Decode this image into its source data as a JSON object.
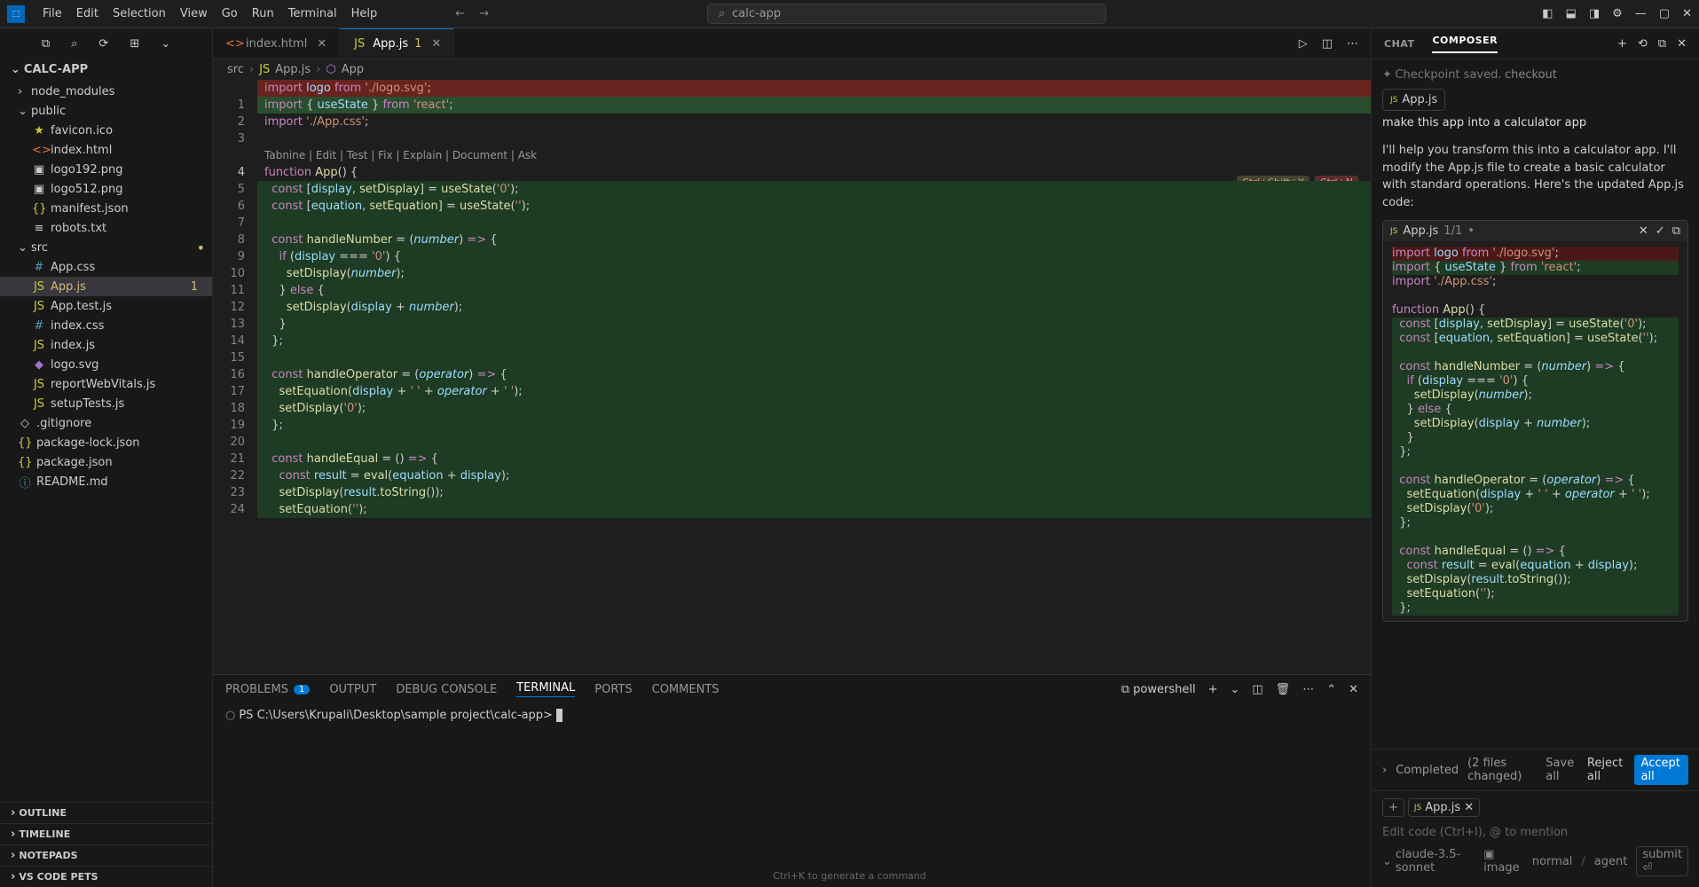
{
  "menubar": {
    "items": [
      "File",
      "Edit",
      "Selection",
      "View",
      "Go",
      "Run",
      "Terminal",
      "Help"
    ],
    "search": "calc-app"
  },
  "explorer": {
    "title": "CALC-APP",
    "tree": [
      {
        "type": "folder",
        "name": "node_modules",
        "expanded": false,
        "depth": 0
      },
      {
        "type": "folder",
        "name": "public",
        "expanded": true,
        "depth": 0
      },
      {
        "type": "file",
        "name": "favicon.ico",
        "icon": "star",
        "depth": 1
      },
      {
        "type": "file",
        "name": "index.html",
        "icon": "html",
        "depth": 1
      },
      {
        "type": "file",
        "name": "logo192.png",
        "icon": "img",
        "depth": 1
      },
      {
        "type": "file",
        "name": "logo512.png",
        "icon": "img",
        "depth": 1
      },
      {
        "type": "file",
        "name": "manifest.json",
        "icon": "json",
        "depth": 1
      },
      {
        "type": "file",
        "name": "robots.txt",
        "icon": "txt",
        "depth": 1
      },
      {
        "type": "folder",
        "name": "src",
        "expanded": true,
        "depth": 0,
        "modified": true
      },
      {
        "type": "file",
        "name": "App.css",
        "icon": "css",
        "depth": 1
      },
      {
        "type": "file",
        "name": "App.js",
        "icon": "js",
        "depth": 1,
        "selected": true,
        "badge": "1"
      },
      {
        "type": "file",
        "name": "App.test.js",
        "icon": "js",
        "depth": 1
      },
      {
        "type": "file",
        "name": "index.css",
        "icon": "css",
        "depth": 1
      },
      {
        "type": "file",
        "name": "index.js",
        "icon": "js",
        "depth": 1
      },
      {
        "type": "file",
        "name": "logo.svg",
        "icon": "svg",
        "depth": 1
      },
      {
        "type": "file",
        "name": "reportWebVitals.js",
        "icon": "js",
        "depth": 1
      },
      {
        "type": "file",
        "name": "setupTests.js",
        "icon": "js",
        "depth": 1
      },
      {
        "type": "file",
        "name": ".gitignore",
        "icon": "git",
        "depth": 0
      },
      {
        "type": "file",
        "name": "package-lock.json",
        "icon": "json",
        "depth": 0
      },
      {
        "type": "file",
        "name": "package.json",
        "icon": "json",
        "depth": 0
      },
      {
        "type": "file",
        "name": "README.md",
        "icon": "md",
        "depth": 0
      }
    ],
    "sections": [
      "OUTLINE",
      "TIMELINE",
      "NOTEPADS",
      "VS CODE PETS"
    ]
  },
  "tabs": [
    {
      "name": "index.html",
      "icon": "html",
      "active": false
    },
    {
      "name": "App.js",
      "icon": "js",
      "active": true,
      "badge": "1"
    }
  ],
  "breadcrumb": [
    "src",
    "App.js",
    "App"
  ],
  "editor": {
    "hints": [
      "Ctrl+Shift+Y",
      "Ctrl+N"
    ],
    "codelens": "Tabnine | Edit | Test | Fix | Explain | Document | Ask",
    "lines": [
      {
        "n": "",
        "cls": "hl-red",
        "html": "<span class='kw'>import</span> <span class='var'>logo</span> <span class='kw'>from</span> <span class='str'>'./logo.svg'</span>;"
      },
      {
        "n": "1",
        "cls": "hl-grn",
        "html": "<span class='kw'>import</span> { <span class='var'>useState</span> } <span class='kw'>from</span> <span class='str'>'react'</span>;"
      },
      {
        "n": "2",
        "html": "<span class='kw'>import</span> <span class='str'>'./App.css'</span>;"
      },
      {
        "n": "3",
        "html": ""
      },
      {
        "n": "4",
        "cur": true,
        "html": "<span class='kw'>function</span> <span class='fn'>App</span>() {"
      },
      {
        "n": "5",
        "cls": "hl-grn2",
        "html": "  <span class='kw'>const</span> [<span class='var'>display</span>, <span class='fn'>setDisplay</span>] = <span class='fn'>useState</span>(<span class='str'>'0'</span>);"
      },
      {
        "n": "6",
        "cls": "hl-grn2",
        "html": "  <span class='kw'>const</span> [<span class='var'>equation</span>, <span class='fn'>setEquation</span>] = <span class='fn'>useState</span>(<span class='str'>''</span>);"
      },
      {
        "n": "7",
        "cls": "hl-grn2",
        "html": ""
      },
      {
        "n": "8",
        "cls": "hl-grn2",
        "html": "  <span class='kw'>const</span> <span class='fn'>handleNumber</span> = (<span class='param'>number</span>) <span class='kw'>=&gt;</span> {"
      },
      {
        "n": "9",
        "cls": "hl-grn2",
        "html": "    <span class='kw'>if</span> (<span class='var'>display</span> === <span class='str'>'0'</span>) {"
      },
      {
        "n": "10",
        "cls": "hl-grn2",
        "html": "      <span class='fn'>setDisplay</span>(<span class='param'>number</span>);"
      },
      {
        "n": "11",
        "cls": "hl-grn2",
        "html": "    } <span class='kw'>else</span> {"
      },
      {
        "n": "12",
        "cls": "hl-grn2",
        "html": "      <span class='fn'>setDisplay</span>(<span class='var'>display</span> + <span class='param'>number</span>);"
      },
      {
        "n": "13",
        "cls": "hl-grn2",
        "html": "    }"
      },
      {
        "n": "14",
        "cls": "hl-grn2",
        "html": "  };"
      },
      {
        "n": "15",
        "cls": "hl-grn2",
        "html": ""
      },
      {
        "n": "16",
        "cls": "hl-grn2",
        "html": "  <span class='kw'>const</span> <span class='fn'>handleOperator</span> = (<span class='param'>operator</span>) <span class='kw'>=&gt;</span> {"
      },
      {
        "n": "17",
        "cls": "hl-grn2",
        "html": "    <span class='fn'>setEquation</span>(<span class='var'>display</span> + <span class='str'>' '</span> + <span class='param'>operator</span> + <span class='str'>' '</span>);"
      },
      {
        "n": "18",
        "cls": "hl-grn2",
        "html": "    <span class='fn'>setDisplay</span>(<span class='str'>'0'</span>);"
      },
      {
        "n": "19",
        "cls": "hl-grn2",
        "html": "  };"
      },
      {
        "n": "20",
        "cls": "hl-grn2",
        "html": ""
      },
      {
        "n": "21",
        "cls": "hl-grn2",
        "html": "  <span class='kw'>const</span> <span class='fn'>handleEqual</span> = () <span class='kw'>=&gt;</span> {"
      },
      {
        "n": "22",
        "cls": "hl-grn2",
        "html": "    <span class='kw'>const</span> <span class='var'>result</span> = <span class='fn'>eval</span>(<span class='var'>equation</span> + <span class='var'>display</span>);"
      },
      {
        "n": "23",
        "cls": "hl-grn2",
        "html": "    <span class='fn'>setDisplay</span>(<span class='var'>result</span>.<span class='fn'>toString</span>());"
      },
      {
        "n": "24",
        "cls": "hl-grn2",
        "html": "    <span class='fn'>setEquation</span>(<span class='str'>''</span>);"
      }
    ]
  },
  "panel": {
    "tabs": [
      "PROBLEMS",
      "OUTPUT",
      "DEBUG CONSOLE",
      "TERMINAL",
      "PORTS",
      "COMMENTS"
    ],
    "active": "TERMINAL",
    "problems_badge": "1",
    "shell": "powershell",
    "prompt": "PS C:\\Users\\Krupali\\Desktop\\sample project\\calc-app>",
    "ghost": "Ctrl+K to generate a command"
  },
  "composer": {
    "tabs": [
      "CHAT",
      "COMPOSER"
    ],
    "active": "COMPOSER",
    "checkpoint": "Checkpoint saved.",
    "checkpoint_action": "checkout",
    "context_file": "App.js",
    "user": "make this app into a calculator app",
    "assistant": "I'll help you transform this into a calculator app. I'll modify the App.js file to create a basic calculator with standard operations. Here's the updated App.js code:",
    "codeblock": {
      "file": "App.js",
      "meta": "1/1",
      "lines": [
        {
          "cls": "hl-red",
          "html": "<span class='kw'>import</span> <span class='var'>logo</span> <span class='kw'>from</span> <span class='str'>'./logo.svg'</span>;"
        },
        {
          "cls": "hl-grn",
          "html": "<span class='kw'>import</span> { <span class='var'>useState</span> } <span class='kw'>from</span> <span class='str'>'react'</span>;"
        },
        {
          "html": "<span class='kw'>import</span> <span class='str'>'./App.css'</span>;"
        },
        {
          "html": ""
        },
        {
          "html": "<span class='kw'>function</span> <span class='fn'>App</span>() {"
        },
        {
          "cls": "hl-grn",
          "html": "  <span class='kw'>const</span> [<span class='var'>display</span>, <span class='fn'>setDisplay</span>] = <span class='fn'>useState</span>(<span class='str'>'0'</span>);"
        },
        {
          "cls": "hl-grn",
          "html": "  <span class='kw'>const</span> [<span class='var'>equation</span>, <span class='fn'>setEquation</span>] = <span class='fn'>useState</span>(<span class='str'>''</span>);"
        },
        {
          "cls": "hl-grn",
          "html": ""
        },
        {
          "cls": "hl-grn",
          "html": "  <span class='kw'>const</span> <span class='fn'>handleNumber</span> = (<span class='param'>number</span>) <span class='kw'>=&gt;</span> {"
        },
        {
          "cls": "hl-grn",
          "html": "    <span class='kw'>if</span> (<span class='var'>display</span> === <span class='str'>'0'</span>) {"
        },
        {
          "cls": "hl-grn",
          "html": "      <span class='fn'>setDisplay</span>(<span class='param'>number</span>);"
        },
        {
          "cls": "hl-grn",
          "html": "    } <span class='kw'>else</span> {"
        },
        {
          "cls": "hl-grn",
          "html": "      <span class='fn'>setDisplay</span>(<span class='var'>display</span> + <span class='param'>number</span>);"
        },
        {
          "cls": "hl-grn",
          "html": "    }"
        },
        {
          "cls": "hl-grn",
          "html": "  };"
        },
        {
          "cls": "hl-grn",
          "html": ""
        },
        {
          "cls": "hl-grn",
          "html": "  <span class='kw'>const</span> <span class='fn'>handleOperator</span> = (<span class='param'>operator</span>) <span class='kw'>=&gt;</span> {"
        },
        {
          "cls": "hl-grn",
          "html": "    <span class='fn'>setEquation</span>(<span class='var'>display</span> + <span class='str'>' '</span> + <span class='param'>operator</span> + <span class='str'>' '</span>);"
        },
        {
          "cls": "hl-grn",
          "html": "    <span class='fn'>setDisplay</span>(<span class='str'>'0'</span>);"
        },
        {
          "cls": "hl-grn",
          "html": "  };"
        },
        {
          "cls": "hl-grn",
          "html": ""
        },
        {
          "cls": "hl-grn",
          "html": "  <span class='kw'>const</span> <span class='fn'>handleEqual</span> = () <span class='kw'>=&gt;</span> {"
        },
        {
          "cls": "hl-grn",
          "html": "    <span class='kw'>const</span> <span class='var'>result</span> = <span class='fn'>eval</span>(<span class='var'>equation</span> + <span class='var'>display</span>);"
        },
        {
          "cls": "hl-grn",
          "html": "    <span class='fn'>setDisplay</span>(<span class='var'>result</span>.<span class='fn'>toString</span>());"
        },
        {
          "cls": "hl-grn",
          "html": "    <span class='fn'>setEquation</span>(<span class='str'>''</span>);"
        },
        {
          "cls": "hl-grn",
          "html": "  };"
        }
      ]
    },
    "status": {
      "text": "Completed",
      "detail": "(2 files changed)",
      "save": "Save all",
      "reject": "Reject all",
      "accept": "Accept all"
    },
    "chip_file": "App.js",
    "placeholder": "Edit code (Ctrl+I), @ to mention",
    "model": "claude-3.5-sonnet",
    "image": "image",
    "mode": "normal",
    "agent": "agent",
    "submit": "submit"
  }
}
